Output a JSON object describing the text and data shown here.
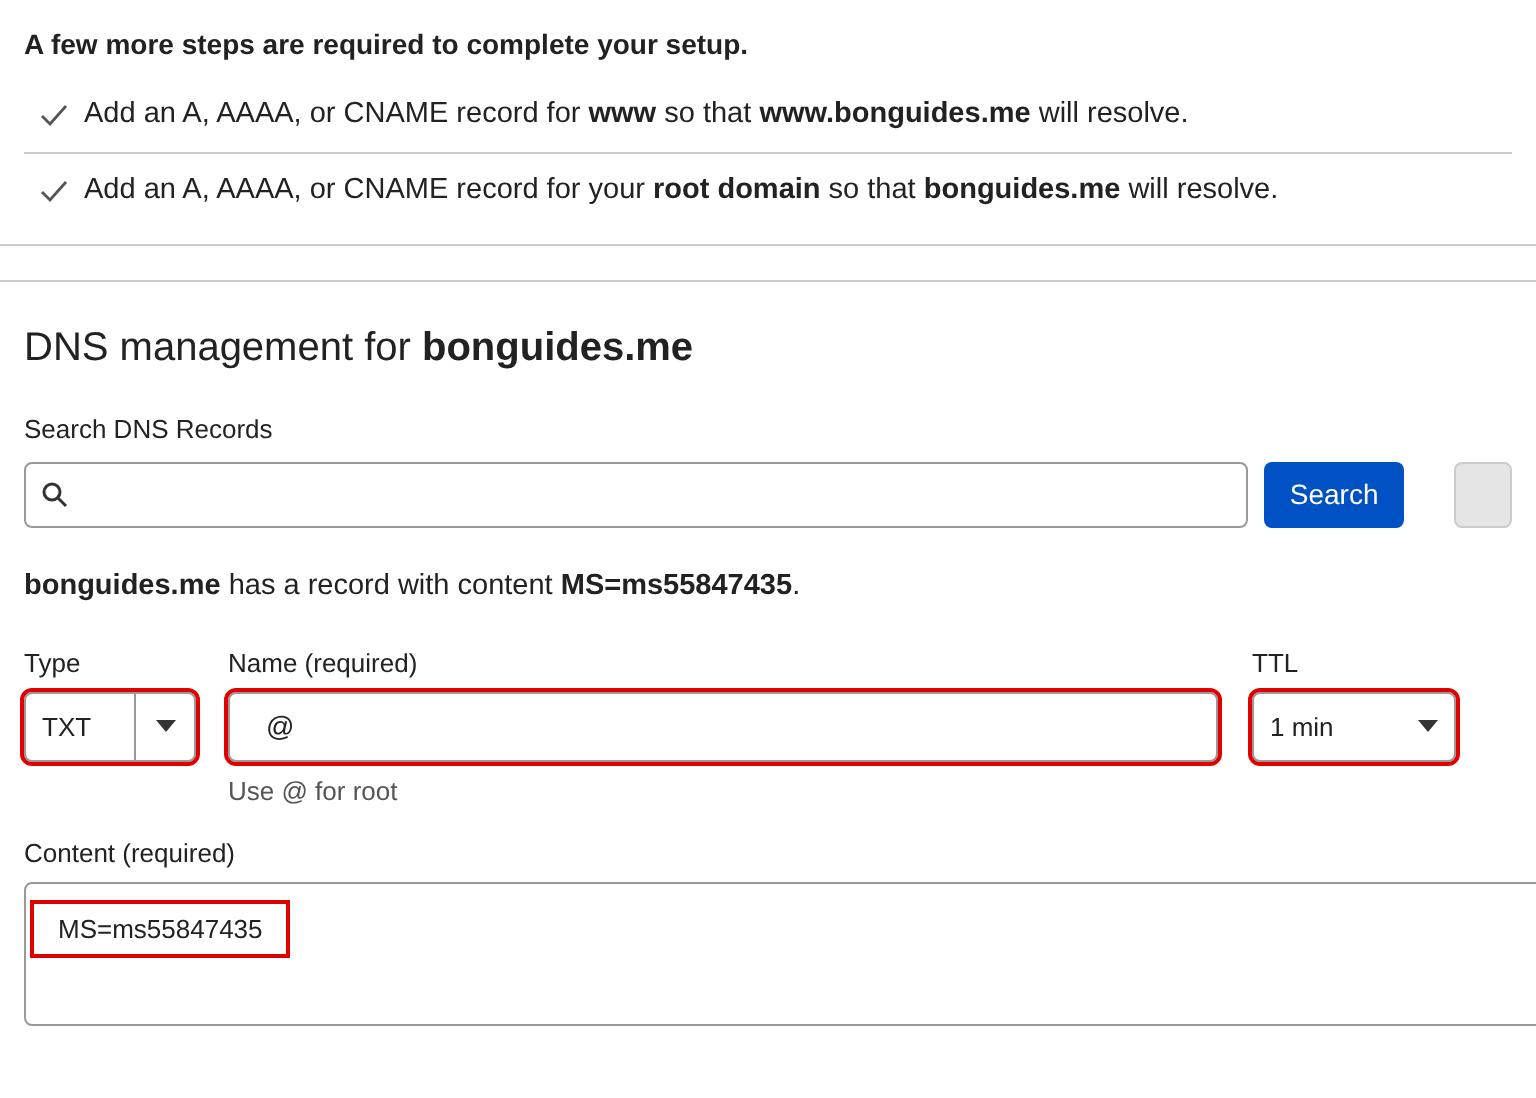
{
  "setup": {
    "heading": "A few more steps are required to complete your setup.",
    "steps": [
      {
        "text": "Add an A, AAAA, or CNAME record for **www** so that **www.bonguides.me** will resolve.",
        "done": true
      },
      {
        "text": "Add an A, AAAA, or CNAME record for your **root domain** so that **bonguides.me** will resolve.",
        "done": true
      }
    ]
  },
  "dns": {
    "title": "DNS management for **bonguides.me**",
    "search": {
      "label": "Search DNS Records",
      "button": "Search"
    },
    "notice": "**bonguides.me** has a record with content **MS=ms55847435**.",
    "form": {
      "type": {
        "label": "Type",
        "value": "TXT",
        "highlighted": true
      },
      "name": {
        "label": "Name (required)",
        "value": "@",
        "hint": "Use @ for root",
        "highlighted": true
      },
      "ttl": {
        "label": "TTL",
        "value": "1 min",
        "highlighted": true
      },
      "content": {
        "label": "Content (required)",
        "value": "MS=ms55847435",
        "highlighted": true
      }
    }
  }
}
